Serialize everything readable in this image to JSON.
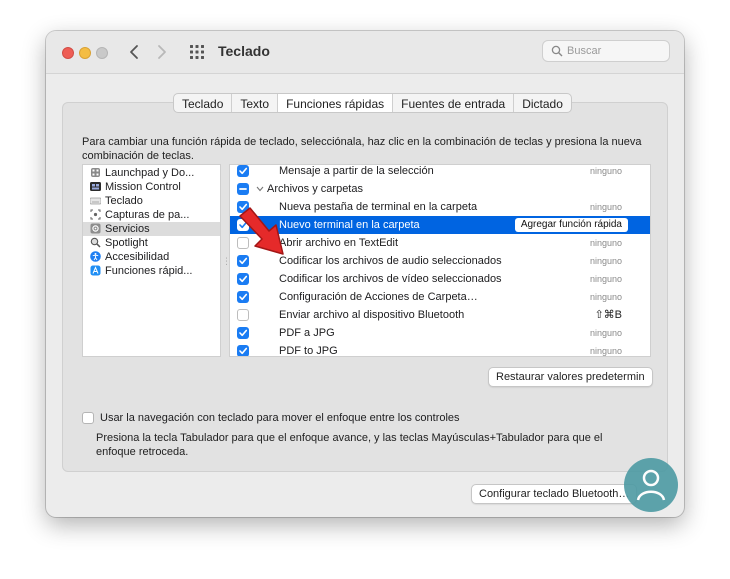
{
  "window": {
    "title": "Teclado"
  },
  "search": {
    "placeholder": "Buscar",
    "icon": "search-icon"
  },
  "tabs": [
    {
      "label": "Teclado",
      "active": false
    },
    {
      "label": "Texto",
      "active": false
    },
    {
      "label": "Funciones rápidas",
      "active": true
    },
    {
      "label": "Fuentes de entrada",
      "active": false
    },
    {
      "label": "Dictado",
      "active": false
    }
  ],
  "description": "Para cambiar una función rápida de teclado, selecciónala, haz clic en la combinación de teclas y presiona la nueva combinación de teclas.",
  "sidebar": {
    "items": [
      {
        "label": "Launchpad y Do...",
        "icon": "launchpad-icon",
        "selected": false
      },
      {
        "label": "Mission Control",
        "icon": "mission-control-icon",
        "selected": false
      },
      {
        "label": "Teclado",
        "icon": "keyboard-icon",
        "selected": false
      },
      {
        "label": "Capturas de pa...",
        "icon": "screenshot-icon",
        "selected": false
      },
      {
        "label": "Servicios",
        "icon": "gear-icon",
        "selected": true
      },
      {
        "label": "Spotlight",
        "icon": "spotlight-icon",
        "selected": false
      },
      {
        "label": "Accesibilidad",
        "icon": "accessibility-icon",
        "selected": false
      },
      {
        "label": "Funciones rápid...",
        "icon": "app-shortcuts-icon",
        "selected": false
      }
    ]
  },
  "services": {
    "rows": [
      {
        "type": "item",
        "label": "Mensaje a partir de la selección",
        "checked": "on",
        "key": "ninguno"
      },
      {
        "type": "group",
        "label": "Archivos y carpetas",
        "checked": "mixed",
        "key": ""
      },
      {
        "type": "item",
        "label": "Nueva pestaña de terminal en la carpeta",
        "checked": "on",
        "key": "ninguno"
      },
      {
        "type": "item",
        "label": "Nuevo terminal en la carpeta",
        "checked": "on",
        "key": "",
        "selected": true,
        "action": "Agregar función rápida"
      },
      {
        "type": "item",
        "label": "Abrir archivo en TextEdit",
        "checked": "off",
        "key": "ninguno"
      },
      {
        "type": "item",
        "label": "Codificar los archivos de audio seleccionados",
        "checked": "on",
        "key": "ninguno"
      },
      {
        "type": "item",
        "label": "Codificar los archivos de vídeo seleccionados",
        "checked": "on",
        "key": "ninguno"
      },
      {
        "type": "item",
        "label": "Configuración de Acciones de Carpeta…",
        "checked": "on",
        "key": "ninguno"
      },
      {
        "type": "item",
        "label": "Enviar archivo al dispositivo Bluetooth",
        "checked": "off",
        "key": "⇧⌘B",
        "key_bold": true
      },
      {
        "type": "item",
        "label": "PDF a JPG",
        "checked": "on",
        "key": "ninguno"
      },
      {
        "type": "item",
        "label": "PDF to JPG",
        "checked": "on",
        "key": "ninguno"
      }
    ]
  },
  "buttons": {
    "restore": "Restaurar valores predetermin",
    "bluetooth": "Configurar teclado Bluetooth…"
  },
  "keyboard_nav": {
    "label": "Usar la navegación con teclado para mover el enfoque entre los controles",
    "checked": false,
    "hint": "Presiona la tecla Tabulador para que el enfoque avance, y las teclas Mayúsculas+Tabulador para que el enfoque retroceda."
  },
  "colors": {
    "accent": "#0064e1",
    "checkbox": "#1a7cf3",
    "arrow": "#e52a2a"
  }
}
